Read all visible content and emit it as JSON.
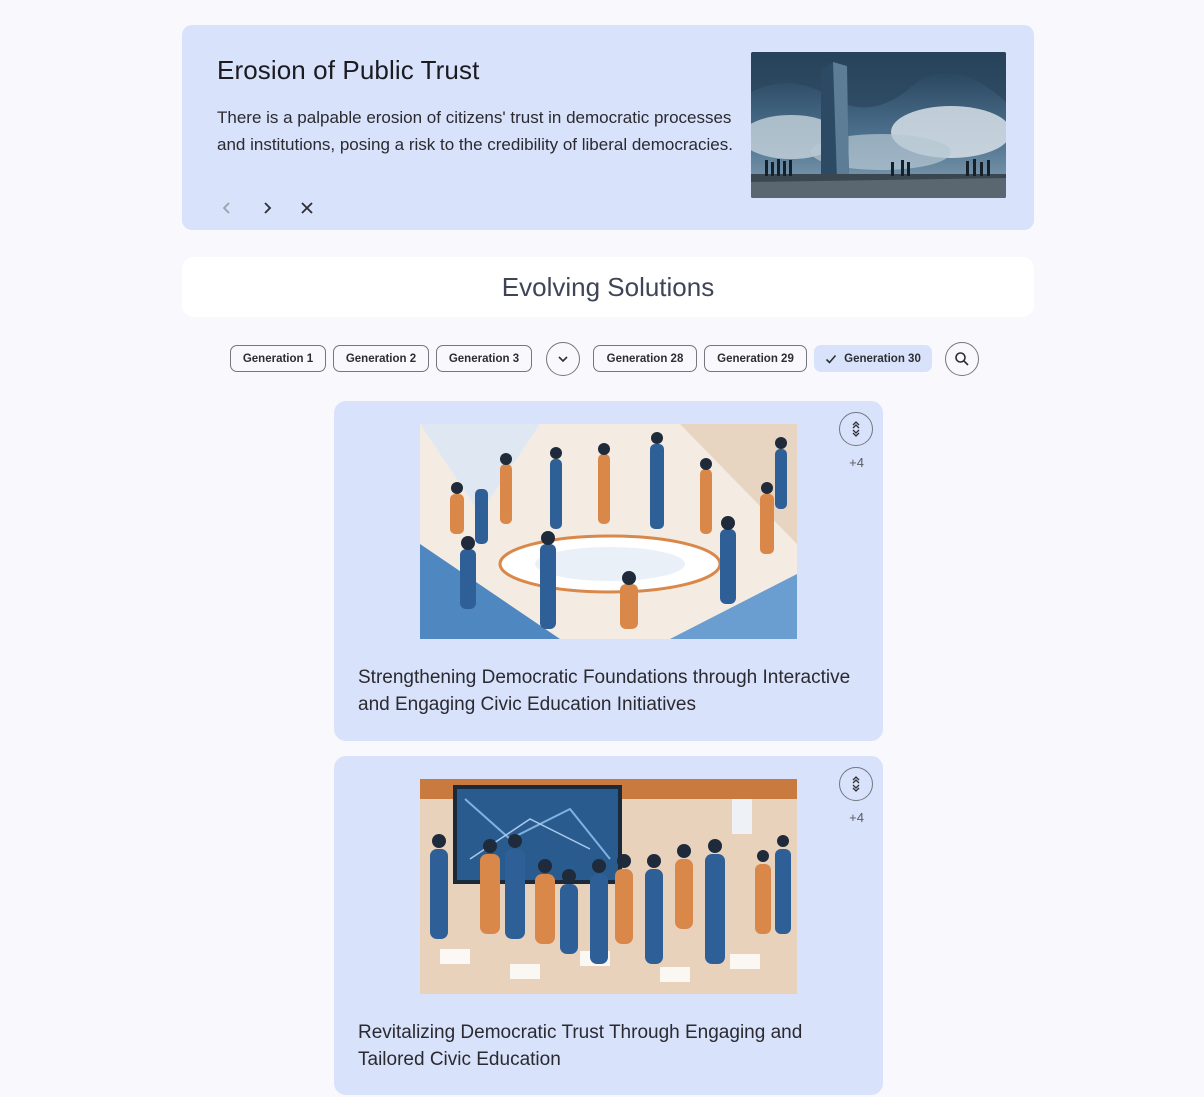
{
  "problem": {
    "title": "Erosion of Public Trust",
    "description": "There is a palpable erosion of citizens' trust in democratic processes and institutions, posing a risk to the credibility of liberal democracies.",
    "nav": {
      "prev_icon": "chevron-left-icon",
      "next_icon": "chevron-right-icon",
      "close_icon": "close-icon"
    }
  },
  "section": {
    "title": "Evolving Solutions"
  },
  "generations": {
    "chips": [
      "Generation 1",
      "Generation 2",
      "Generation 3",
      "Generation 28",
      "Generation 29",
      "Generation 30"
    ],
    "selected": "Generation 30",
    "expand_icon": "chevron-down-icon",
    "search_icon": "search-icon"
  },
  "solutions": [
    {
      "title": "Strengthening Democratic Foundations through Interactive and Engaging Civic Education Initiatives",
      "votes": "+4"
    },
    {
      "title": "Revitalizing Democratic Trust Through Engaging and Tailored Civic Education",
      "votes": "+4"
    }
  ],
  "colors": {
    "card": "#d8e2fa",
    "background": "#f8f8fd",
    "accent_blue": "#3a6ea8",
    "accent_orange": "#d9884a"
  }
}
